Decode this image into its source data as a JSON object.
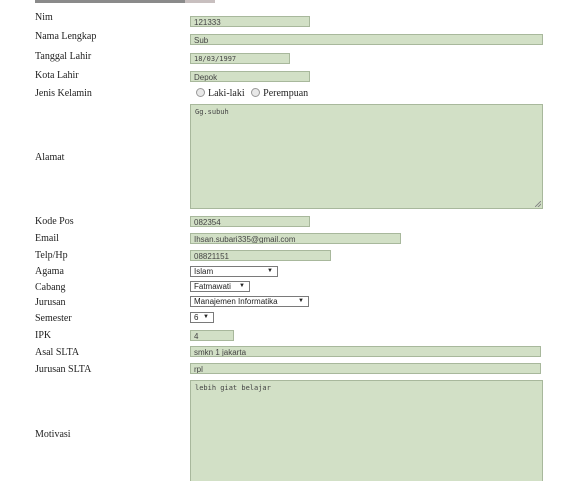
{
  "form": {
    "nim": {
      "label": "Nim",
      "value": "121333"
    },
    "nama": {
      "label": "Nama Lengkap",
      "value": "Sub"
    },
    "tanggal": {
      "label": "Tanggal Lahir",
      "value": "18/03/1997"
    },
    "kota": {
      "label": "Kota Lahir",
      "value": "Depok"
    },
    "jenis_kelamin": {
      "label": "Jenis Kelamin",
      "options": [
        "Laki-laki",
        "Perempuan"
      ]
    },
    "alamat": {
      "label": "Alamat",
      "value": "Gg.subuh"
    },
    "kode_pos": {
      "label": "Kode Pos",
      "value": "082354"
    },
    "email": {
      "label": "Email",
      "value": "Ihsan.subari335@gmail.com"
    },
    "telp": {
      "label": "Telp/Hp",
      "value": "08821151"
    },
    "agama": {
      "label": "Agama",
      "value": "Islam"
    },
    "cabang": {
      "label": "Cabang",
      "value": "Fatmawati"
    },
    "jurusan": {
      "label": "Jurusan",
      "value": "Manajemen Informatika"
    },
    "semester": {
      "label": "Semester",
      "value": "6"
    },
    "ipk": {
      "label": "IPK",
      "value": "4"
    },
    "asal_slta": {
      "label": "Asal SLTA",
      "value": "smkn 1 jakarta"
    },
    "jurusan_slta": {
      "label": "Jurusan SLTA",
      "value": "rpl"
    },
    "motivasi": {
      "label": "Motivasi",
      "value": "lebih giat belajar"
    }
  },
  "icons": {
    "select_caret": "caret-down-icon",
    "resize": "resize-grip-icon"
  },
  "colors": {
    "field_bg": "#d2e0c6",
    "field_border": "#a8b89c"
  }
}
